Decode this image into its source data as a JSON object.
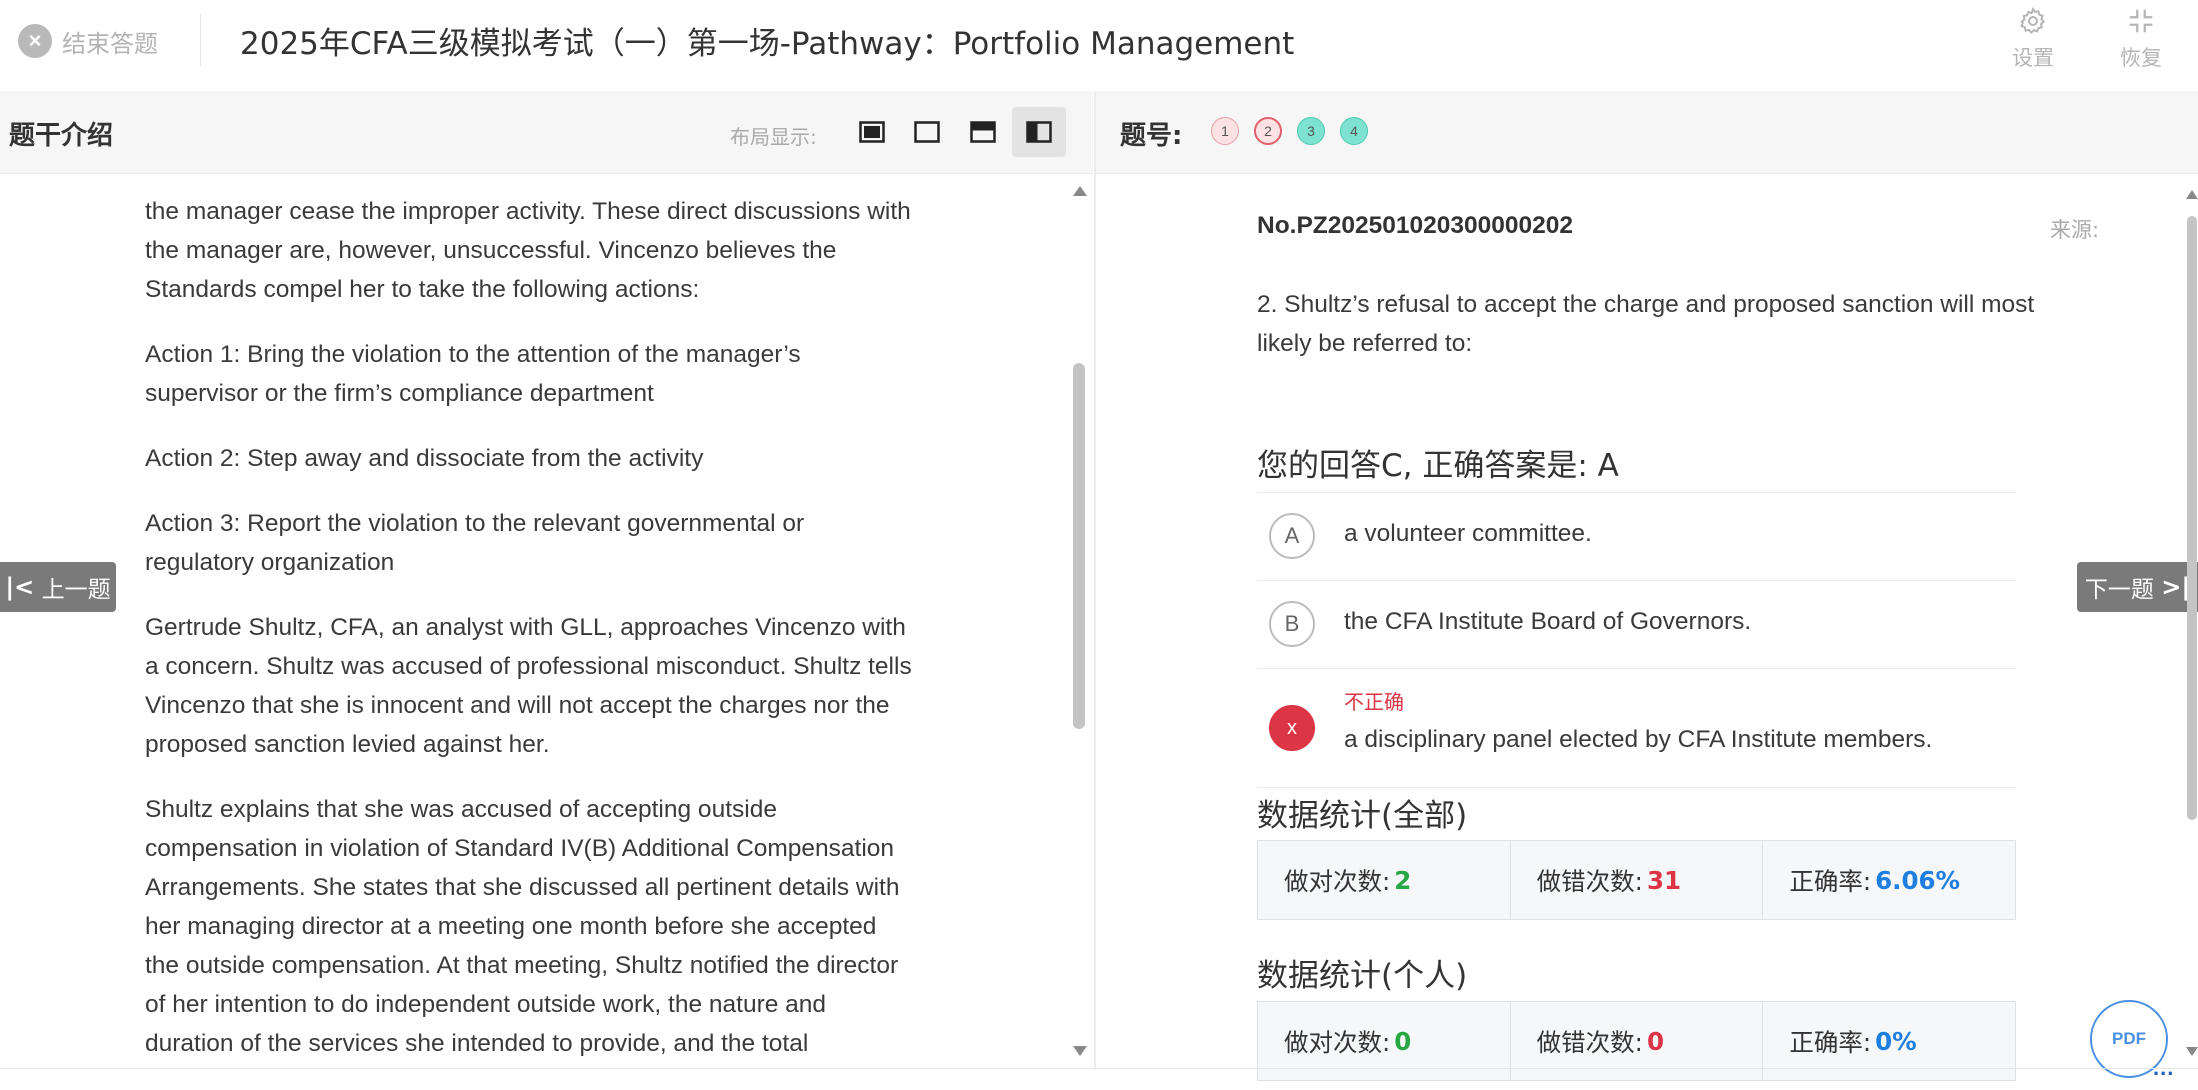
{
  "header": {
    "end_exam_label": "结束答题",
    "exam_title": "2025年CFA三级模拟考试（一）第一场-Pathway：Portfolio Management",
    "settings_label": "设置",
    "restore_label": "恢复"
  },
  "left_panel": {
    "title": "题干介绍",
    "layout_label": "布局显示:",
    "layout_options": [
      "layout-full",
      "layout-empty",
      "layout-top",
      "layout-side"
    ],
    "active_layout": "layout-side",
    "paragraphs": [
      "the manager cease the improper activity. These direct discussions with the manager are, however, unsuccessful. Vincenzo believes the Standards compel her to take the following actions:",
      "Action 1: Bring the violation to the attention of the manager’s supervisor or the firm’s compliance department",
      "Action 2: Step away and dissociate from the activity",
      "Action 3: Report the violation to the relevant governmental or regulatory organization",
      "Gertrude Shultz, CFA, an analyst with GLL, approaches Vincenzo with a concern. Shultz was accused of professional misconduct. Shultz tells Vincenzo that she is innocent and will not accept the charges nor the proposed sanction levied against her.",
      "Shultz explains that she was accused of accepting outside compensation in violation of Standard IV(B) Additional Compensation Arrangements. She states that she discussed all pertinent details with her managing director at a meeting one month before she accepted the outside compensation. At that meeting, Shultz notified the director of her intention to do independent outside work, the nature and duration of the services she intended to provide, and the total compensation she"
    ]
  },
  "nav": {
    "prev_label": "上一题",
    "next_label": "下一题"
  },
  "right_panel": {
    "qno_label": "题号:",
    "question_dots": [
      {
        "num": "1",
        "state": "wrong"
      },
      {
        "num": "2",
        "state": "wrong-current"
      },
      {
        "num": "3",
        "state": "right"
      },
      {
        "num": "4",
        "state": "right"
      }
    ],
    "question_id": "No.PZ202501020300000202",
    "source_label": "来源:",
    "question_text": "2. Shultz’s refusal to accept the charge and proposed sanction will most likely be referred to:",
    "answer_summary": "您的回答C, 正确答案是: A",
    "options": [
      {
        "letter": "A",
        "text": "a volunteer committee."
      },
      {
        "letter": "B",
        "text": "the CFA Institute Board of Governors."
      },
      {
        "letter": "x",
        "text": "a disciplinary panel elected by CFA Institute members.",
        "tag": "不正确"
      }
    ],
    "stats_all": {
      "title": "数据统计(全部)",
      "correct_label": "做对次数:",
      "correct_value": "2",
      "wrong_label": "做错次数:",
      "wrong_value": "31",
      "rate_label": "正确率:",
      "rate_value": "6.06%"
    },
    "stats_personal": {
      "title": "数据统计(个人)",
      "correct_label": "做对次数:",
      "correct_value": "0",
      "wrong_label": "做错次数:",
      "wrong_value": "0",
      "rate_label": "正确率:",
      "rate_value": "0%"
    }
  },
  "pdf_button": {
    "label": "PDF",
    "more": "..."
  },
  "colors": {
    "correct_green": "#28a745",
    "wrong_red": "#dc3545",
    "rate_blue": "#1e7fe0",
    "wrong_dot": "#fde2e4",
    "right_dot": "#7de3d0"
  }
}
